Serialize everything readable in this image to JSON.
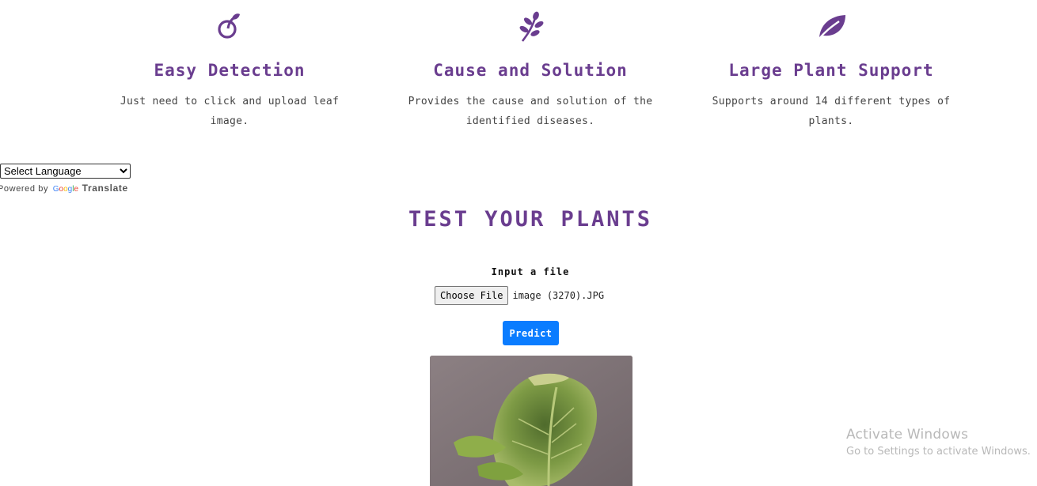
{
  "features": [
    {
      "icon": "seedling-icon",
      "title": "Easy Detection",
      "description": "Just need to click and upload leaf image."
    },
    {
      "icon": "herb-icon",
      "title": "Cause and Solution",
      "description": "Provides the cause and solution of the identified diseases."
    },
    {
      "icon": "leaf-icon",
      "title": "Large Plant Support",
      "description": "Supports around 14 different types of plants."
    }
  ],
  "language": {
    "select_label": "Select Language",
    "powered_prefix": "Powered by",
    "google": "Google",
    "translate": "Translate"
  },
  "test_section": {
    "title": "TEST YOUR PLANTS",
    "input_label": "Input a file",
    "choose_file_label": "Choose File",
    "file_name": "image (3270).JPG",
    "predict_label": "Predict"
  },
  "watermark": {
    "line1": "Activate Windows",
    "line2": "Go to Settings to activate Windows."
  },
  "colors": {
    "accent_purple": "#6a3d8f",
    "predict_blue": "#0a7cff"
  }
}
